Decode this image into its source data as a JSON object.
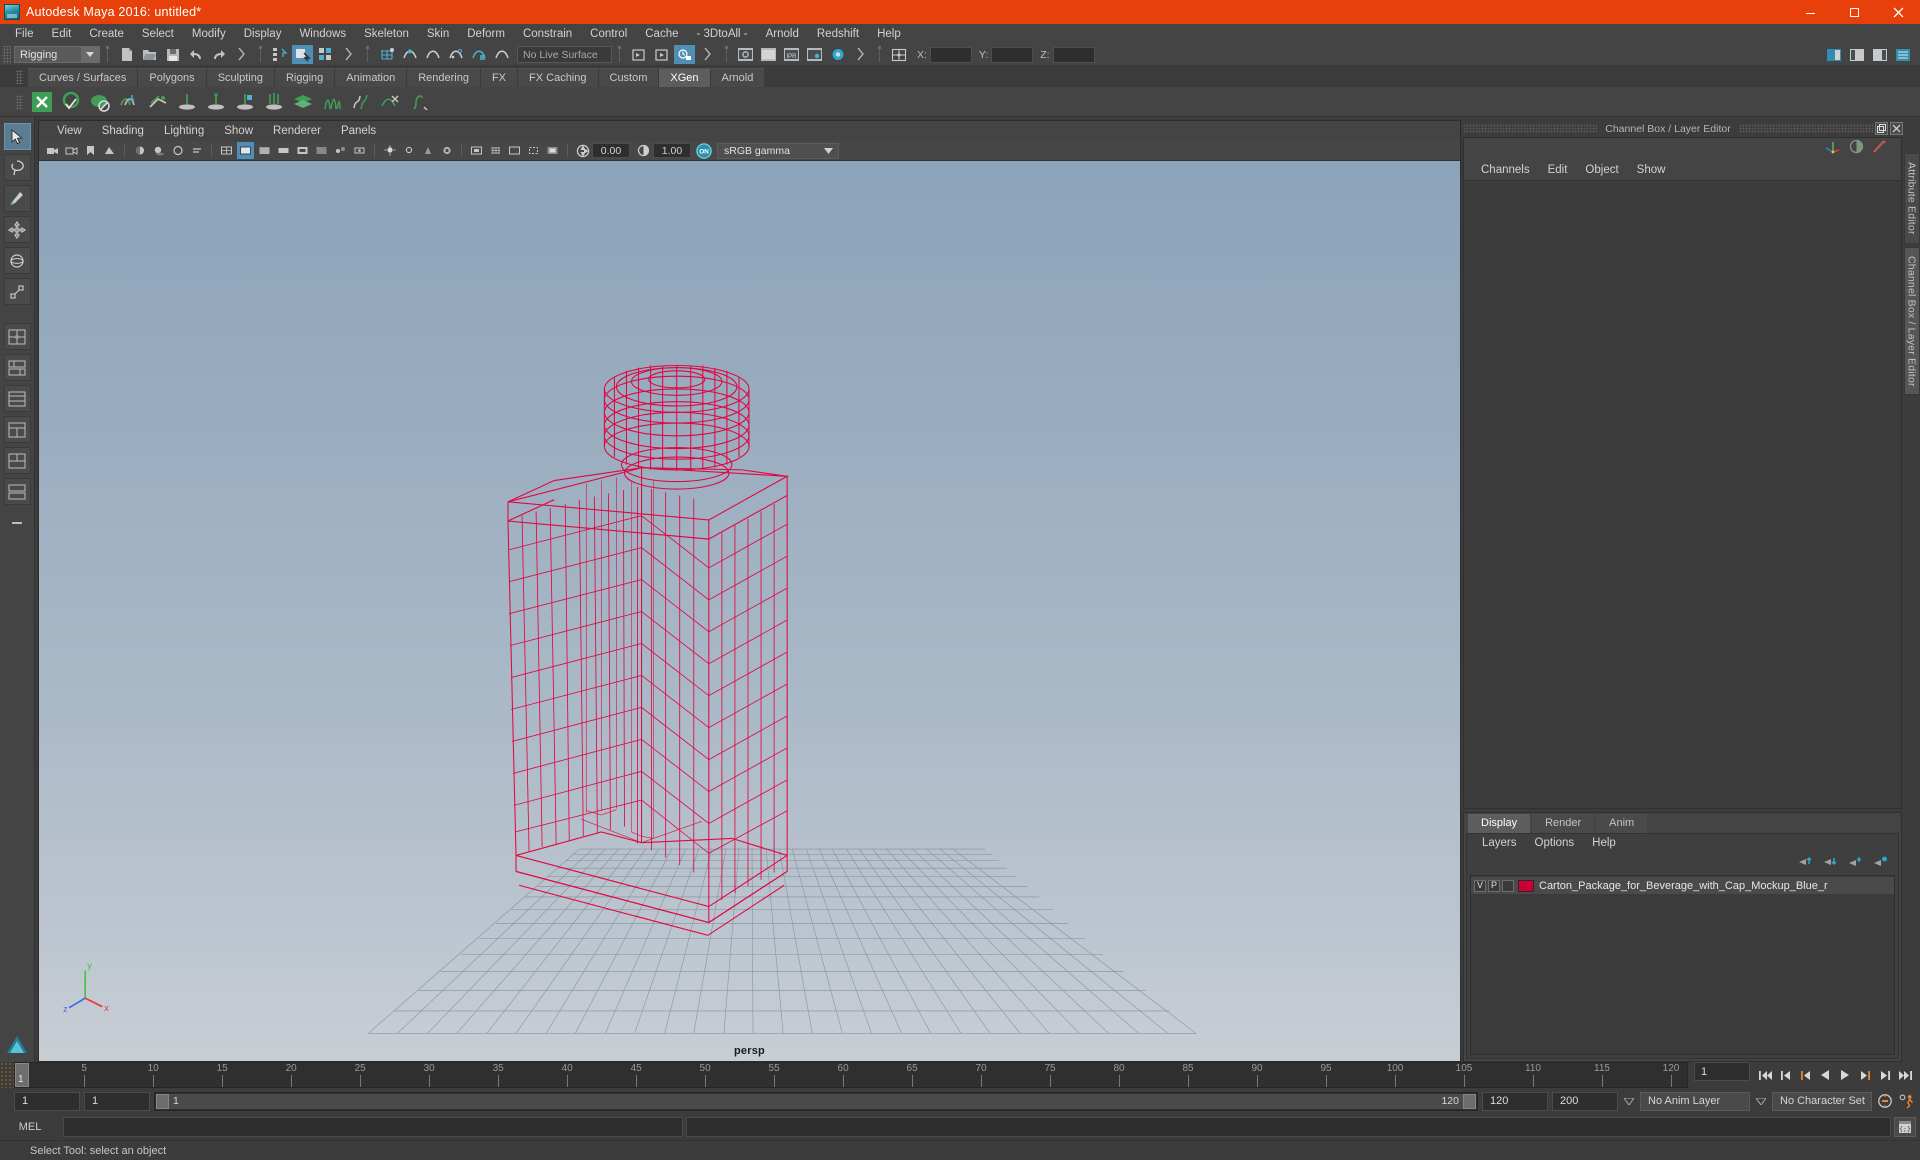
{
  "window": {
    "title": "Autodesk Maya 2016: untitled*",
    "logo_icon": "maya-logo-icon",
    "minimize_icon": "minimize-icon",
    "maximize_icon": "maximize-icon",
    "close_icon": "close-icon"
  },
  "menubar": {
    "items": [
      "File",
      "Edit",
      "Create",
      "Select",
      "Modify",
      "Display",
      "Windows",
      "Skeleton",
      "Skin",
      "Deform",
      "Constrain",
      "Control",
      "Cache",
      "- 3DtoAll -",
      "Arnold",
      "Redshift",
      "Help"
    ]
  },
  "statusbar": {
    "mode": "Rigging",
    "live_surface": "No Live Surface",
    "coord_labels": [
      "X:",
      "Y:",
      "Z:"
    ],
    "coord_values": [
      "",
      "",
      ""
    ],
    "icons": [
      "new-scene-icon",
      "open-scene-icon",
      "save-scene-icon",
      "undo-icon",
      "redo-icon",
      "select-by-hierarchy-icon",
      "select-by-object-icon",
      "select-by-component-icon",
      "snap-to-grid-icon",
      "snap-to-curve-icon",
      "snap-to-point-icon",
      "snap-to-projected-center-icon",
      "snap-to-view-plane-icon",
      "snap-to-uv-icon",
      "make-live-icon",
      "show-manipulator-icon",
      "render-view-icon",
      "open-render-view-icon",
      "render-current-frame-icon",
      "ipr-render-icon",
      "render-settings-icon",
      "hypershade-icon",
      "editor-layout-icon"
    ],
    "right_icons": [
      "sidebar-attribute-editor-icon",
      "sidebar-tool-settings-icon",
      "sidebar-channel-box-icon",
      "sidebar-outliner-icon"
    ]
  },
  "shelf": {
    "tabs": [
      "Curves / Surfaces",
      "Polygons",
      "Sculpting",
      "Rigging",
      "Animation",
      "Rendering",
      "FX",
      "FX Caching",
      "Custom",
      "XGen",
      "Arnold"
    ],
    "active_tab": "XGen",
    "items": [
      "xgen-editor-icon",
      "create-description-icon",
      "create-collection-icon",
      "import-collection-icon",
      "export-collection-icon",
      "add-guide-icon",
      "edit-guide-icon",
      "lock-guide-icon",
      "density-brush-icon",
      "grooming-layers-icon",
      "clump-modifier-icon",
      "noise-modifier-icon",
      "cut-modifier-icon",
      "coil-modifier-icon"
    ]
  },
  "tools": {
    "items": [
      {
        "name": "select-tool",
        "selected": true
      },
      {
        "name": "lasso-select-tool",
        "selected": false
      },
      {
        "name": "paint-select-tool",
        "selected": false
      },
      {
        "name": "move-tool",
        "selected": false
      },
      {
        "name": "rotate-tool",
        "selected": false
      },
      {
        "name": "scale-tool",
        "selected": false
      },
      {
        "name": "last-tool-used",
        "selected": false
      },
      {
        "name": "four-view-layout-icon",
        "selected": false
      },
      {
        "name": "persp-outliner-layout-icon",
        "selected": false
      },
      {
        "name": "persp-graph-layout-icon",
        "selected": false
      },
      {
        "name": "persp-hypershade-layout-icon",
        "selected": false
      },
      {
        "name": "two-pane-layout-icon",
        "selected": false
      },
      {
        "name": "single-pane-layout-icon",
        "selected": false
      },
      {
        "name": "collapse-layout-icon",
        "selected": false
      }
    ]
  },
  "viewport": {
    "menus": [
      "View",
      "Shading",
      "Lighting",
      "Show",
      "Renderer",
      "Panels"
    ],
    "camera_label": "persp",
    "exposure_value": "0.00",
    "gamma_value": "1.00",
    "color_management": "sRGB gamma",
    "cm_toggle_label": "ON",
    "toolbar_icons": [
      "select-camera-icon",
      "camera-attributes-icon",
      "bookmarks-icon",
      "image-plane-icon",
      "two-sided-lighting-icon",
      "shadows-icon",
      "ao-icon",
      "motion-blur-icon",
      "wireframe-icon",
      "smooth-shade-all-icon",
      "smooth-shade-textured-icon",
      "flat-shade-icon",
      "wireframe-on-shaded-icon",
      "xray-icon",
      "xray-joints-icon",
      "xray-active-components-icon",
      "use-default-lighting-icon",
      "use-all-lights-icon",
      "shadow-toggle-icon",
      "screen-space-ao-icon",
      "motion-blur-toggle-icon",
      "multisample-aa-icon",
      "depth-of-field-icon",
      "isolate-select-icon",
      "grid-toggle-icon",
      "film-gate-icon",
      "resolution-gate-icon",
      "gate-mask-icon",
      "exposure-icon",
      "gamma-icon",
      "color-management-icon"
    ],
    "model": {
      "name": "Carton_Package_for_Beverage_with_Cap_Mockup_Blue",
      "wireframe_color": "#e2003c",
      "shading": "wireframe"
    },
    "gizmo_axes": [
      "x",
      "y",
      "z"
    ]
  },
  "channel_box": {
    "panel_title": "Channel Box / Layer Editor",
    "menus": [
      "Channels",
      "Edit",
      "Object",
      "Show"
    ],
    "header_icons": [
      "channel-box-icon",
      "attribute-editor-toggle-icon",
      "modeling-toolkit-icon"
    ],
    "float_icon": "undock-icon",
    "close_icon": "close-panel-icon"
  },
  "layer_editor": {
    "tabs": [
      "Display",
      "Render",
      "Anim"
    ],
    "active_tab": "Display",
    "menus": [
      "Layers",
      "Options",
      "Help"
    ],
    "toolbar_icons": [
      "move-layer-up-icon",
      "move-layer-down-icon",
      "new-layer-icon",
      "new-layer-from-selected-icon"
    ],
    "layers": [
      {
        "visibility": "V",
        "playback": "P",
        "shading": "",
        "color": "#cc0033",
        "name": "Carton_Package_for_Beverage_with_Cap_Mockup_Blue_r"
      }
    ]
  },
  "side_tabs": {
    "items": [
      "Attribute Editor",
      "Channel Box / Layer Editor"
    ]
  },
  "timeline": {
    "start": 1,
    "end": 120,
    "current_frame": "1",
    "tick_labels": [
      "5",
      "10",
      "15",
      "20",
      "25",
      "30",
      "35",
      "40",
      "45",
      "50",
      "55",
      "60",
      "65",
      "70",
      "75",
      "80",
      "85",
      "90",
      "95",
      "100",
      "105",
      "110",
      "115",
      "120"
    ],
    "playback_icons": [
      "go-to-start-icon",
      "step-back-keyframe-icon",
      "step-back-frame-icon",
      "play-backwards-icon",
      "play-forwards-icon",
      "step-forward-frame-icon",
      "step-forward-keyframe-icon",
      "go-to-end-icon"
    ]
  },
  "range_bar": {
    "range_start": "1",
    "range_start_2": "1",
    "slider_left_label": "1",
    "slider_right_label": "120",
    "range_end": "120",
    "playback_end": "200",
    "anim_layer": "No Anim Layer",
    "character_set": "No Character Set",
    "auto_key_icon": "auto-keyframe-icon",
    "prefs_icon": "animation-preferences-icon"
  },
  "command_line": {
    "language": "MEL",
    "input_value": "",
    "output_value": "",
    "script_editor_icon": "script-editor-icon"
  },
  "help_line": {
    "message": "Select Tool: select an object"
  },
  "colors": {
    "title_bar": "#e8400a",
    "chrome": "#444444",
    "accent_blue": "#4f8fb5",
    "wire_red": "#e2003c",
    "layer_red": "#cc0033"
  }
}
